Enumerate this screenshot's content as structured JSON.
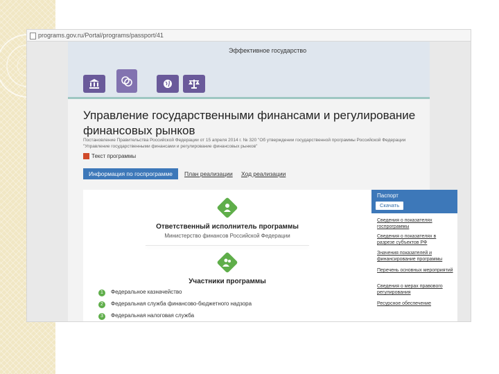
{
  "browser": {
    "url": "programs.gov.ru/Portal/programs/passport/41"
  },
  "header": {
    "title": "Эффективное государство"
  },
  "icons": [
    "institution-icon",
    "coins-icon",
    "globe-icon",
    "scales-icon"
  ],
  "page": {
    "title": "Управление государственными финансами и регулирование финансовых рынков",
    "description": "Постановление Правительства Российской Федерации от 15 апреля 2014 г. № 320 \"Об утверждении государственной программы Российской Федерации \"Управление государственными финансами и регулирование финансовых рынков\"",
    "pdf_link": "Текст программы"
  },
  "tabs": [
    {
      "label": "Информация по госпрограмме"
    },
    {
      "label": "План реализации"
    },
    {
      "label": "Ход реализации"
    }
  ],
  "content": {
    "responsible_title": "Ответственный исполнитель программы",
    "responsible_value": "Министерство финансов Российской Федерации",
    "participants_title": "Участники программы",
    "participants": [
      {
        "num": "1",
        "name": "Федеральное казначейство"
      },
      {
        "num": "2",
        "name": "Федеральная служба финансово-бюджетного надзора"
      },
      {
        "num": "3",
        "name": "Федеральная налоговая служба"
      }
    ]
  },
  "right_panel": {
    "title": "Паспорт",
    "download": "Скачать",
    "items": [
      "Сведения о показателях госпрограммы",
      "Сведения о показателях в разрезе субъектов РФ",
      "Значения показателей и финансирование программы",
      "Перечень основных мероприятий",
      "Сведения о мерах правового регулирования",
      "Ресурсное обеспечение"
    ]
  },
  "colors": {
    "accent": "#3d78b9",
    "icon": "#6a5a9a",
    "green": "#5fae4a"
  }
}
